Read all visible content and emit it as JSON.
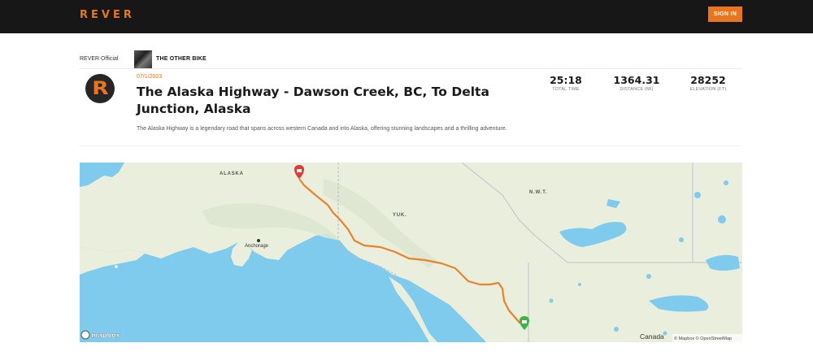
{
  "nav": {
    "logo": "REVER",
    "sign_in": "SIGN IN"
  },
  "breadcrumb": {
    "official": "REVER Official",
    "bike": "THE OTHER BIKE"
  },
  "ride": {
    "date": "07/1/2023",
    "title": "The Alaska Highway - Dawson Creek, BC, To Delta Junction, Alaska",
    "description": "The Alaska Highway is a legendary road that spans across western Canada and into Alaska, offering stunning landscapes and a thrilling adventure."
  },
  "stats": [
    {
      "value": "25:18",
      "label": "TOTAL TIME"
    },
    {
      "value": "1364.31",
      "label": "DISTANCE (MI)"
    },
    {
      "value": "28252",
      "label": "ELEVATION (FT)"
    }
  ],
  "map": {
    "labels": {
      "alaska": "ALASKA",
      "yukon": "YUK.",
      "nwt": "N.W.T.",
      "anchorage": "Anchorage",
      "canada": "Canada"
    },
    "attribution": "© Mapbox © OpenStreetMap",
    "mapbox_logo": "mapbox",
    "colors": {
      "route": "#e8832a",
      "start": "#3cb44b",
      "end": "#e03a3a",
      "water": "#7ecbee",
      "land": "#e9efdc"
    }
  }
}
